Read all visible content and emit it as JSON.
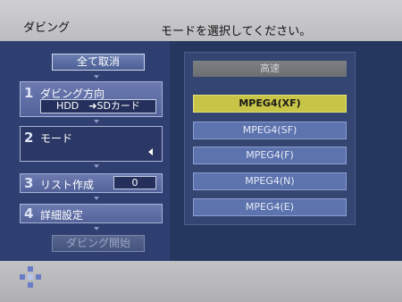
{
  "header": {
    "title": "ダビング",
    "message": "モードを選択してください。"
  },
  "left": {
    "clear_all": "全て取消",
    "steps": [
      {
        "num": "1",
        "label": "ダビング方向",
        "value": "HDD　➜SDカード"
      },
      {
        "num": "2",
        "label": "モード"
      },
      {
        "num": "3",
        "label": "リスト作成",
        "value": "0"
      },
      {
        "num": "4",
        "label": "詳細設定"
      }
    ],
    "start": "ダビング開始"
  },
  "options": {
    "header": "高速",
    "items": [
      "MPEG4(XF)",
      "MPEG4(SF)",
      "MPEG4(F)",
      "MPEG4(N)",
      "MPEG4(E)"
    ],
    "selected_index": 0
  },
  "icons": {
    "mode_arrow": "left-arrow-icon",
    "dpad": "dpad-icon"
  },
  "colors": {
    "panel": "#2f3f72",
    "highlight": "#c7c447",
    "button": "#5d73ae"
  }
}
